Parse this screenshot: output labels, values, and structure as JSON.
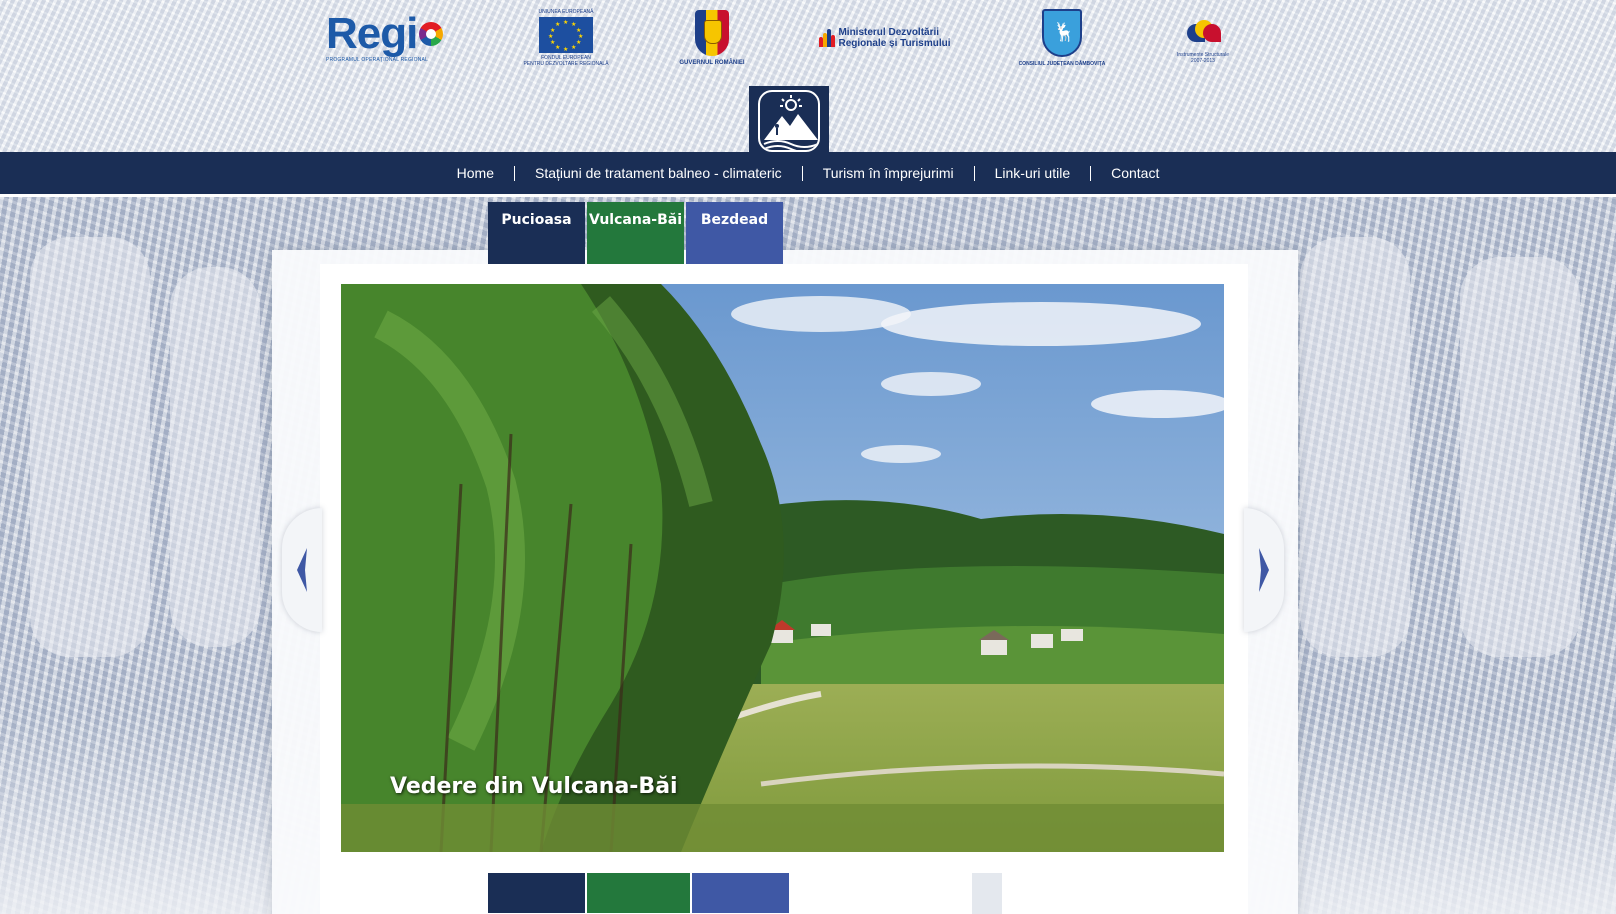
{
  "logos": {
    "regio": {
      "word": "Regi",
      "sub": "PROGRAMUL OPERAȚIONAL REGIONAL"
    },
    "eu": {
      "top": "UNIUNEA EUROPEANĂ",
      "bottom_line1": "FONDUL EUROPEAN",
      "bottom_line2": "PENTRU DEZVOLTARE REGIONALĂ"
    },
    "government": {
      "caption": "GUVERNUL ROMÂNIEI"
    },
    "ministry": {
      "line1": "Ministerul Dezvoltării",
      "line2": "Regionale și Turismului"
    },
    "county_council": {
      "caption": "CONSILIUL JUDEȚEAN DÂMBOVIȚA"
    },
    "structural_instruments": {
      "line1": "Instrumente Structurale",
      "line2": "2007-2013"
    }
  },
  "nav": {
    "items": [
      {
        "label": "Home"
      },
      {
        "label": "Stațiuni de tratament balneo - climateric"
      },
      {
        "label": "Turism în împrejurimi"
      },
      {
        "label": "Link-uri utile"
      },
      {
        "label": "Contact"
      }
    ]
  },
  "location_tabs": [
    {
      "label": "Pucioasa",
      "color": "#1a2e55"
    },
    {
      "label": "Vulcana-Băi",
      "color": "#23783c"
    },
    {
      "label": "Bezdead",
      "color": "#3f58a5"
    }
  ],
  "slider": {
    "caption": "Vedere din Vulcana-Băi",
    "prev_icon": "chevron-left-icon",
    "next_icon": "chevron-right-icon"
  },
  "bottom_blocks": [
    {
      "color": "#1a2e55"
    },
    {
      "color": "#23783c"
    },
    {
      "color": "#3f58a5"
    }
  ],
  "colors": {
    "brand_navy": "#1a2e55",
    "green": "#23783c",
    "blue": "#3f58a5"
  }
}
